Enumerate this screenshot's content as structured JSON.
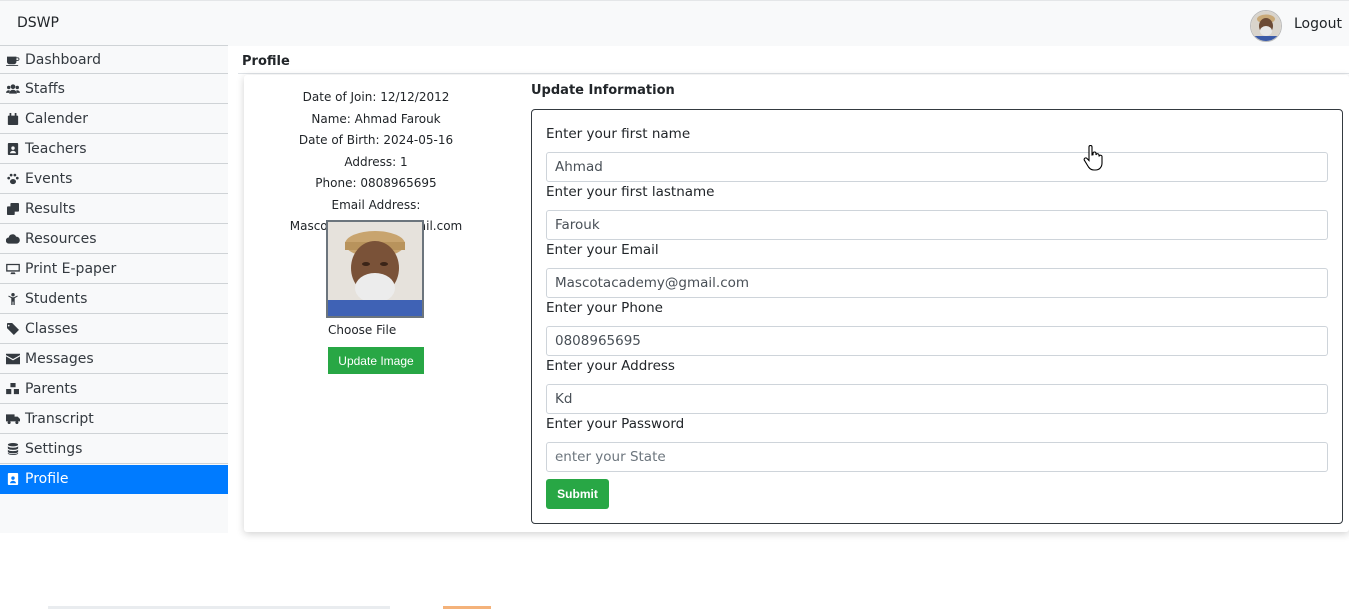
{
  "app": {
    "brand": "DSWP",
    "logout_label": "Logout"
  },
  "sidebar": {
    "items": [
      {
        "label": "Dashboard",
        "icon": "coffee-icon"
      },
      {
        "label": "Staffs",
        "icon": "users-icon"
      },
      {
        "label": "Calender",
        "icon": "calendar-icon"
      },
      {
        "label": "Teachers",
        "icon": "id-badge-icon"
      },
      {
        "label": "Events",
        "icon": "paw-icon"
      },
      {
        "label": "Results",
        "icon": "copy-icon"
      },
      {
        "label": "Resources",
        "icon": "cloud-icon"
      },
      {
        "label": "Print E-paper",
        "icon": "desktop-icon"
      },
      {
        "label": "Students",
        "icon": "child-icon"
      },
      {
        "label": "Classes",
        "icon": "tag-icon"
      },
      {
        "label": "Messages",
        "icon": "envelope-icon"
      },
      {
        "label": "Parents",
        "icon": "cubes-icon"
      },
      {
        "label": "Transcript",
        "icon": "truck-icon"
      },
      {
        "label": "Settings",
        "icon": "database-icon"
      },
      {
        "label": "Profile",
        "icon": "id-badge-icon",
        "active": true
      }
    ],
    "active_color": "#007bff"
  },
  "page": {
    "title": "Profile"
  },
  "profile": {
    "date_of_join": "Date of Join: 12/12/2012",
    "name": "Name: Ahmad Farouk",
    "date_of_birth": "Date of Birth: 2024-05-16",
    "address": "Address: 1",
    "phone": "Phone: 0808965695",
    "email": "Email Address: Mascotacademy@gmail.com",
    "choose_file": "Choose File",
    "update_image_label": "Update Image"
  },
  "form": {
    "title": "Update Information",
    "fields": [
      {
        "label": "Enter your first name",
        "value": "Ahmad",
        "placeholder": ""
      },
      {
        "label": "Enter your first lastname",
        "value": "Farouk",
        "placeholder": ""
      },
      {
        "label": "Enter your Email",
        "value": "Mascotacademy@gmail.com",
        "placeholder": ""
      },
      {
        "label": "Enter your Phone",
        "value": "0808965695",
        "placeholder": ""
      },
      {
        "label": "Enter your Address",
        "value": "Kd",
        "placeholder": ""
      },
      {
        "label": "Enter your Password",
        "value": "",
        "placeholder": "enter your State"
      }
    ],
    "submit_label": "Submit"
  },
  "colors": {
    "green": "#28a745",
    "accent": "#007bff"
  }
}
